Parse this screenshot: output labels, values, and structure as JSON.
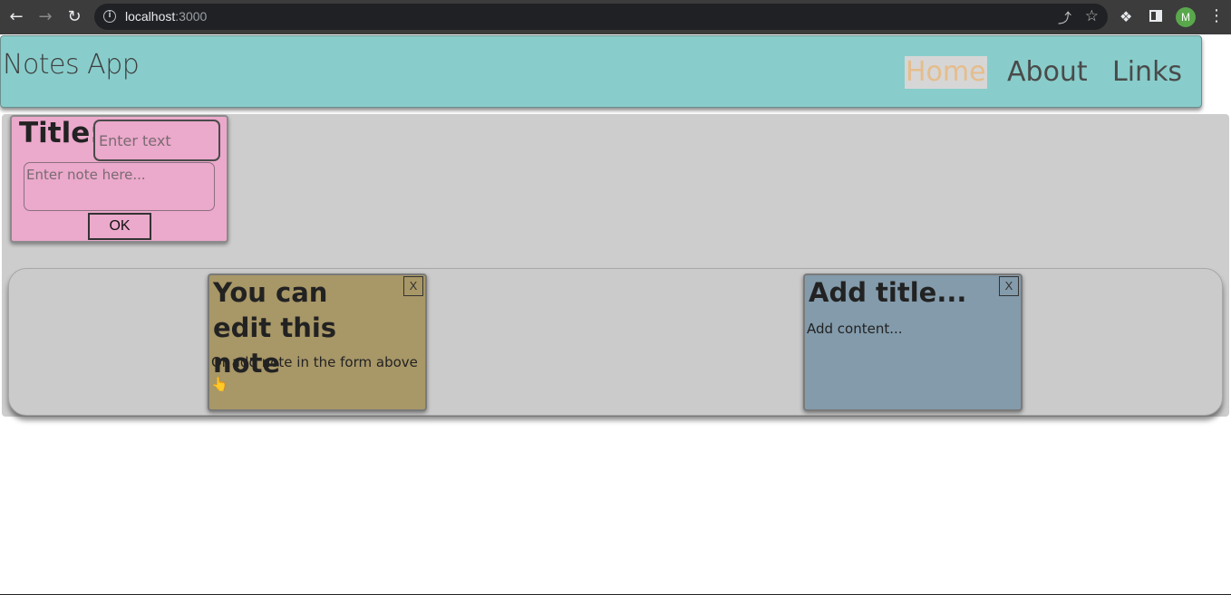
{
  "browser": {
    "url_host": "localhost",
    "url_port": ":3000",
    "avatar_letter": "M"
  },
  "header": {
    "app_title": "Notes App",
    "nav": {
      "home": "Home",
      "about": "About",
      "links": "Links"
    },
    "active_nav_color": "#e5bd8c",
    "background_color": "#88cdcb"
  },
  "form": {
    "title_label": "Title:",
    "title_placeholder": "Enter text",
    "note_placeholder": "Enter note here...",
    "ok_label": "OK",
    "background_color": "#eba9cb"
  },
  "notes": [
    {
      "title": "You can edit this note",
      "content": "Or add note in the form above 👆",
      "close_label": "X",
      "color": "#a89767"
    },
    {
      "title": "Add title...",
      "content": "Add content...",
      "close_label": "X",
      "color": "#839bab"
    }
  ]
}
